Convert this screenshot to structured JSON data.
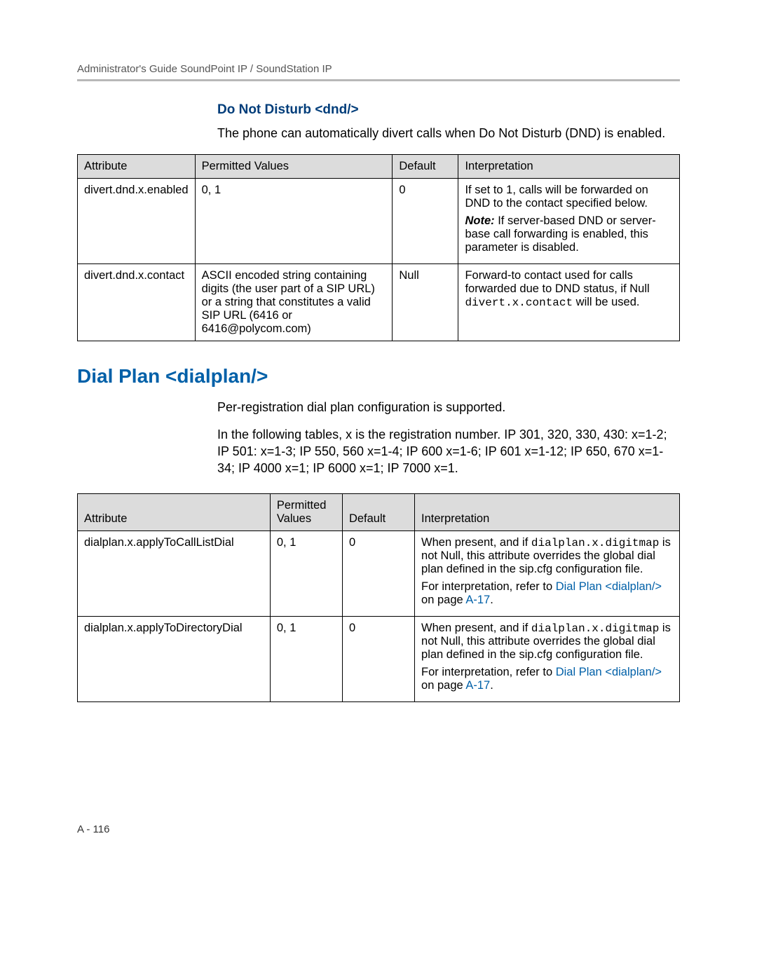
{
  "header": {
    "running": "Administrator's Guide SoundPoint IP / SoundStation IP"
  },
  "section_dnd": {
    "heading": "Do Not Disturb <dnd/>",
    "intro": "The phone can automatically divert calls when Do Not Disturb (DND) is enabled.",
    "columns": {
      "attribute": "Attribute",
      "permitted": "Permitted Values",
      "default": "Default",
      "interpretation": "Interpretation"
    },
    "rows": [
      {
        "attribute": "divert.dnd.x.enabled",
        "permitted": "0, 1",
        "default": "0",
        "interp_p1": "If set to 1, calls will be forwarded on DND to the contact specified below.",
        "interp_note_label": "Note:",
        "interp_note_text": " If server-based DND or server-base call forwarding is enabled, this parameter is disabled."
      },
      {
        "attribute": "divert.dnd.x.contact",
        "permitted": "ASCII encoded string containing digits (the user part of a SIP URL) or a string that constitutes a valid SIP URL (6416 or 6416@polycom.com)",
        "default": "Null",
        "interp_pre": "Forward-to contact used for calls forwarded due to DND status, if Null ",
        "interp_mono": "divert.x.contact",
        "interp_post": " will be used."
      }
    ]
  },
  "section_dialplan": {
    "heading": "Dial Plan <dialplan/>",
    "intro_p1": "Per-registration dial plan  configuration is supported.",
    "intro_p2": "In the following tables,  x is the registration number. IP 301, 320, 330, 430: x=1-2; IP 501: x=1-3; IP 550, 560 x=1-4; IP 600 x=1-6; IP 601 x=1-12; IP 650, 670 x=1-34; IP 4000 x=1; IP 6000 x=1; IP 7000 x=1.",
    "columns": {
      "attribute": "Attribute",
      "permitted": "Permitted Values",
      "default": "Default",
      "interpretation": "Interpretation"
    },
    "rows": [
      {
        "attribute": "dialplan.x.applyToCallListDial",
        "permitted": "0, 1",
        "default": "0",
        "interp_pre": "When present, and if ",
        "interp_mono": "dialplan.x.digitmap",
        "interp_post": " is not Null, this attribute overrides the global dial plan defined in the sip.cfg  configuration file.",
        "interp_ref_pre": "For interpretation, refer to ",
        "interp_ref_link1": "Dial Plan <dialplan/>",
        "interp_ref_mid": " on page ",
        "interp_ref_link2": "A-17",
        "interp_ref_post": "."
      },
      {
        "attribute": "dialplan.x.applyToDirectoryDial",
        "permitted": "0, 1",
        "default": "0",
        "interp_pre": "When present, and if ",
        "interp_mono": "dialplan.x.digitmap",
        "interp_post": " is not Null, this attribute overrides the global dial plan defined in the sip.cfg  configuration file.",
        "interp_ref_pre": "For interpretation, refer to ",
        "interp_ref_link1": "Dial Plan <dialplan/>",
        "interp_ref_mid": " on page ",
        "interp_ref_link2": "A-17",
        "interp_ref_post": "."
      }
    ]
  },
  "page_number": "A - 116"
}
